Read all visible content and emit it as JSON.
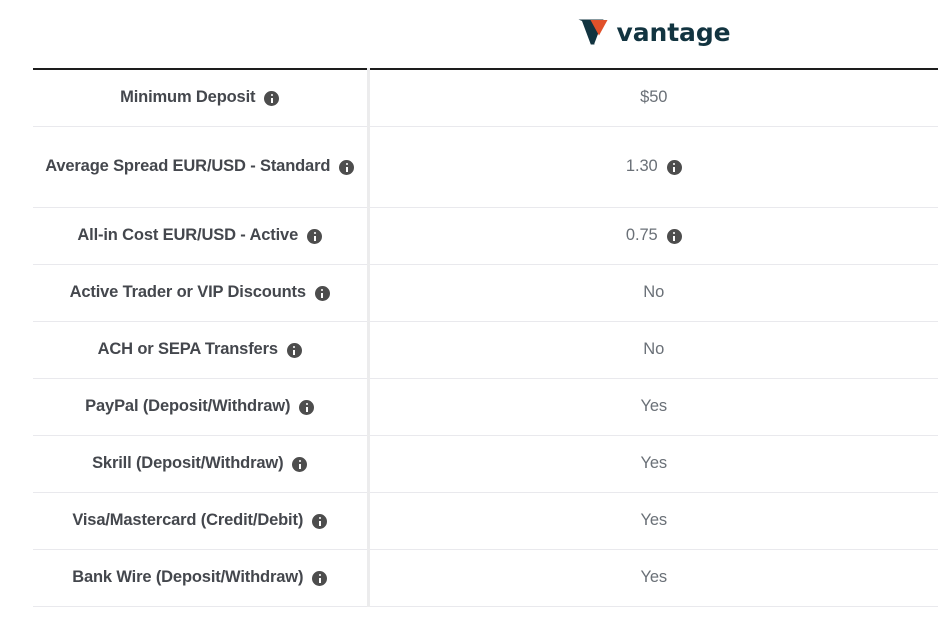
{
  "brand": {
    "name": "vantage",
    "logo_icon": "vantage-v-logo-icon",
    "mark_dark_color": "#123440",
    "mark_accent_color": "#e1512a",
    "wordmark_color": "#123440"
  },
  "table": {
    "top_border_color": "#1d1d1d",
    "row_divider_color": "#e9e9ed",
    "column_divider_color": "#ececed",
    "label_color": "#44474d",
    "value_color": "#6a7077",
    "info_icon_color": "#4d4d4d",
    "info_icon_name": "info-icon",
    "rows": [
      {
        "label": "Minimum Deposit",
        "label_info": true,
        "value": "$50",
        "value_info": false,
        "tall": false
      },
      {
        "label": "Average Spread EUR/USD - Standard",
        "label_info": true,
        "value": "1.30",
        "value_info": true,
        "tall": true
      },
      {
        "label": "All-in Cost EUR/USD - Active",
        "label_info": true,
        "value": "0.75",
        "value_info": true,
        "tall": false
      },
      {
        "label": "Active Trader or VIP Discounts",
        "label_info": true,
        "value": "No",
        "value_info": false,
        "tall": false
      },
      {
        "label": "ACH or SEPA Transfers",
        "label_info": true,
        "value": "No",
        "value_info": false,
        "tall": false
      },
      {
        "label": "PayPal (Deposit/Withdraw)",
        "label_info": true,
        "value": "Yes",
        "value_info": false,
        "tall": false
      },
      {
        "label": "Skrill (Deposit/Withdraw)",
        "label_info": true,
        "value": "Yes",
        "value_info": false,
        "tall": false
      },
      {
        "label": "Visa/Mastercard (Credit/Debit)",
        "label_info": true,
        "value": "Yes",
        "value_info": false,
        "tall": false
      },
      {
        "label": "Bank Wire (Deposit/Withdraw)",
        "label_info": true,
        "value": "Yes",
        "value_info": false,
        "tall": false
      }
    ]
  }
}
